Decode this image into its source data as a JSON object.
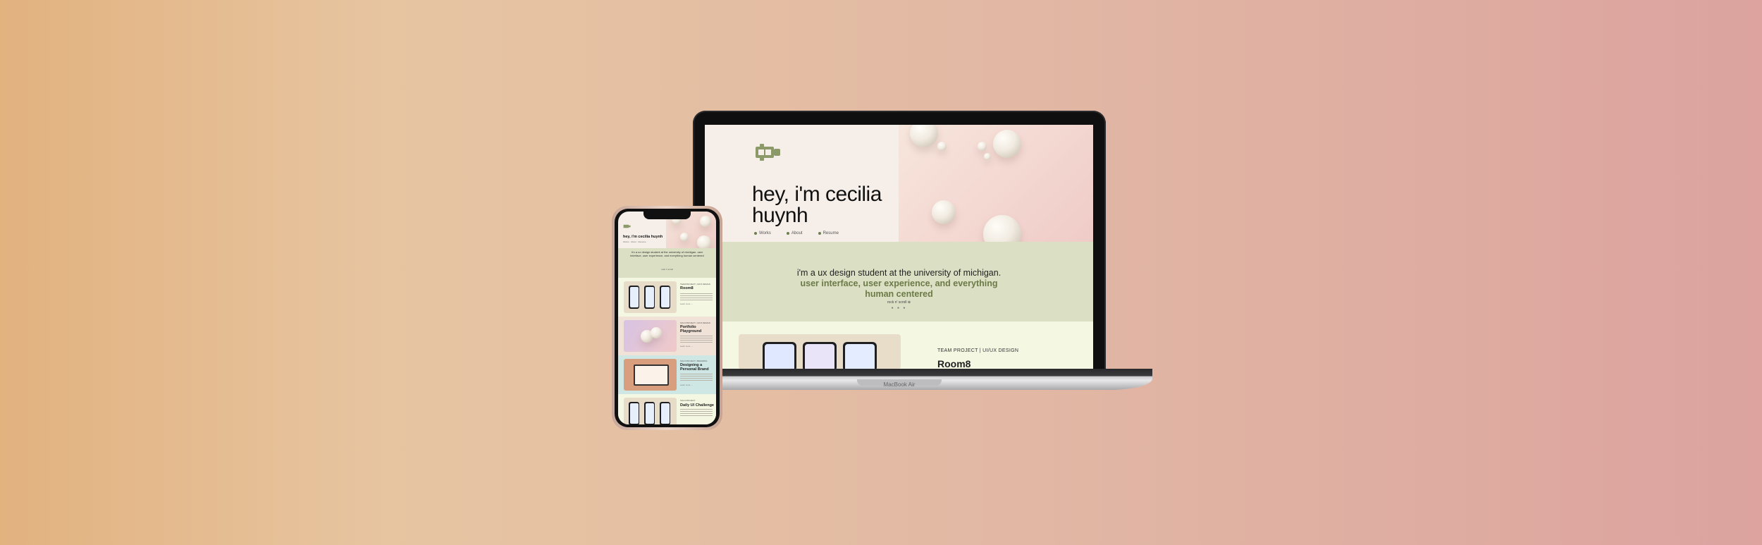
{
  "laptop": {
    "hero_title": "hey, i'm cecilia huynh",
    "nav": [
      {
        "label": "Works"
      },
      {
        "label": "About"
      },
      {
        "label": "Resume"
      }
    ],
    "intro_line1": "i'm a ux design student at the university of michigan.",
    "intro_line2": "user interface, user experience, and everything human centered",
    "scroll_hint": "rock n' scroll ⊕",
    "scroll_dots": "● ● ●",
    "project_tag": "TEAM PROJECT | UI/UX DESIGN",
    "project_title": "Room8",
    "device_label": "MacBook Air"
  },
  "phone": {
    "title": "hey, i'm cecilia huynh",
    "nav": "Works · About · Resume",
    "intro": "i'm a ux design student at the university of michigan. user interface, user experience, and everything human centered",
    "hint": "rock n' scroll",
    "projects": [
      {
        "tag": "TEAM PROJECT | UI/UX DESIGN",
        "title": "Room8",
        "link": "Learn more →"
      },
      {
        "tag": "SOLO PROJECT | UI/UX DESIGN",
        "title": "Portfolio Playground",
        "link": "Learn more →"
      },
      {
        "tag": "SOLO PROJECT | BRANDING",
        "title": "Designing a Personal Brand",
        "link": "Learn more →"
      },
      {
        "tag": "SOLO PROJECT",
        "title": "Daily UI Challenge",
        "link": ""
      }
    ]
  },
  "colors": {
    "sage_band": "#dbdfc4",
    "accent_olive": "#6b7a46",
    "hero_cream": "#f6efe9"
  }
}
